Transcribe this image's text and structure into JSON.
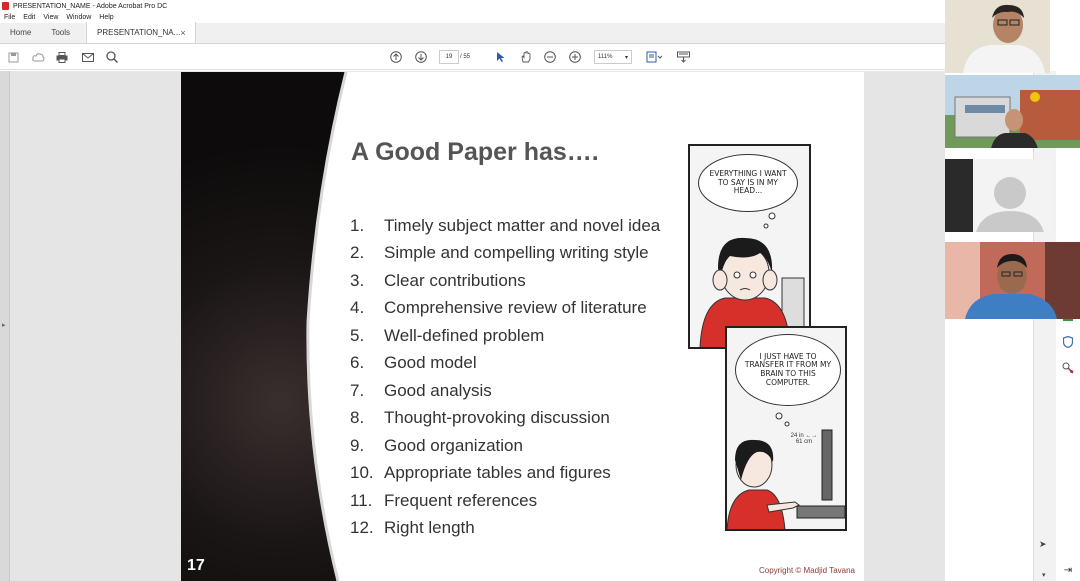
{
  "window": {
    "title": "PRESENTATION_NAME - Adobe Acrobat Pro DC"
  },
  "menu": [
    "File",
    "Edit",
    "View",
    "Window",
    "Help"
  ],
  "tabs": {
    "home": "Home",
    "tools": "Tools",
    "document": "PRESENTATION_NA..."
  },
  "toolbar": {
    "page_current": "19",
    "page_total": "/ 55",
    "zoom": "111%"
  },
  "slide": {
    "title": "A Good Paper has….",
    "number": "17",
    "items": [
      {
        "num": "1.",
        "text": "Timely subject matter and novel idea"
      },
      {
        "num": "2.",
        "text": "Simple and compelling writing style"
      },
      {
        "num": "3.",
        "text": "Clear contributions"
      },
      {
        "num": "4.",
        "text": "Comprehensive review of literature"
      },
      {
        "num": "5.",
        "text": "Well-defined problem"
      },
      {
        "num": "6.",
        "text": "Good model"
      },
      {
        "num": "7.",
        "text": "Good analysis"
      },
      {
        "num": "8.",
        "text": "Thought-provoking discussion"
      },
      {
        "num": "9.",
        "text": "Good organization"
      },
      {
        "num": "10.",
        "text": "Appropriate tables and figures"
      },
      {
        "num": "11.",
        "text": "Frequent references"
      },
      {
        "num": "12.",
        "text": "Right length"
      }
    ],
    "comic_bubble_1": "EVERYTHING I WANT TO SAY IS IN MY HEAD...",
    "comic_bubble_2": "I JUST HAVE TO TRANSFER IT FROM MY BRAIN TO THIS COMPUTER.",
    "comic_measure": "24 in ←→ 61 cm",
    "copyright": "Copyright © Madjid Tavana"
  },
  "colors": {
    "accent": "#d8262f",
    "slide_title": "#555555",
    "copyright": "#8b3a3a"
  }
}
